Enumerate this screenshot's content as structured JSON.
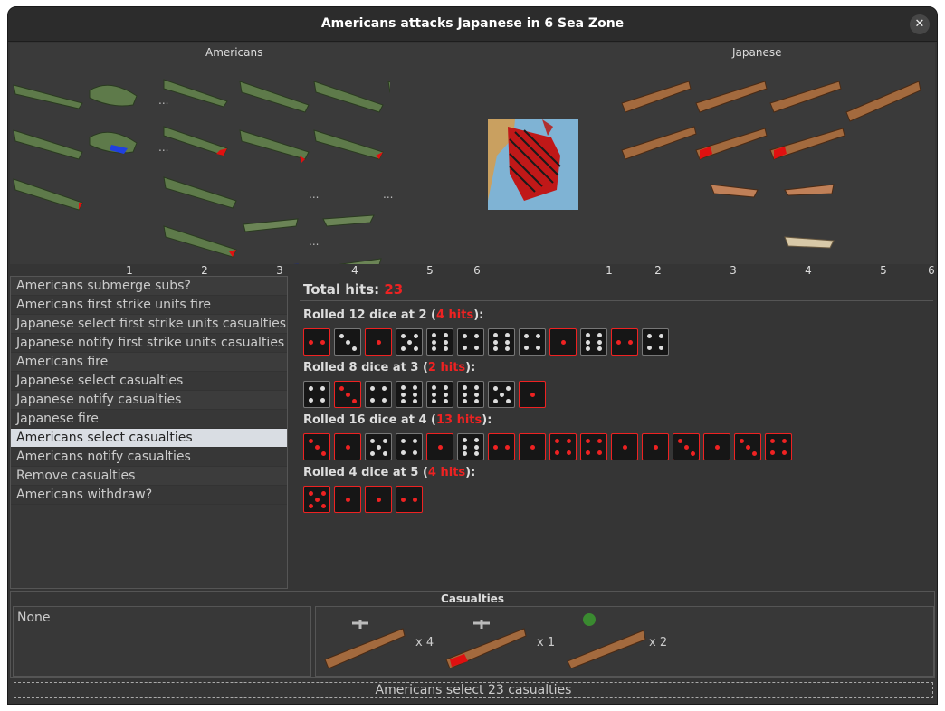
{
  "window": {
    "title": "Americans attacks Japanese in 6 Sea Zone"
  },
  "board": {
    "attacker_label": "Americans",
    "defender_label": "Japanese",
    "attacker_columns": [
      "1",
      "2",
      "3",
      "4",
      "5",
      "6"
    ],
    "defender_columns": [
      "1",
      "2",
      "3",
      "4",
      "5",
      "6"
    ],
    "colors": {
      "american_unit": "#5e7a4a",
      "japanese_unit": "#a36a3e",
      "damage": "#e01010",
      "sea": "#7fb3d4"
    }
  },
  "steps": {
    "items": [
      "Americans submerge subs?",
      "Americans first strike units fire",
      "Japanese select first strike units casualties",
      "Japanese notify first strike units casualties",
      "Americans fire",
      "Japanese select casualties",
      "Japanese notify casualties",
      "Japanese fire",
      "Americans select casualties",
      "Americans notify casualties",
      "Remove casualties",
      "Americans withdraw?"
    ],
    "selected_index": 8
  },
  "dice": {
    "total_label": "Total hits:",
    "total_hits": "23",
    "rolls": [
      {
        "prefix": "Rolled 12 dice at 2 (",
        "hits_text": "4 hits",
        "suffix": "):",
        "faces": [
          2,
          3,
          1,
          5,
          6,
          4,
          6,
          4,
          1,
          6,
          2,
          4
        ],
        "hit": [
          true,
          false,
          true,
          false,
          false,
          false,
          false,
          false,
          true,
          false,
          true,
          false
        ]
      },
      {
        "prefix": "Rolled 8 dice at 3 (",
        "hits_text": "2 hits",
        "suffix": "):",
        "faces": [
          4,
          3,
          4,
          6,
          6,
          6,
          5,
          1
        ],
        "hit": [
          false,
          true,
          false,
          false,
          false,
          false,
          false,
          true
        ]
      },
      {
        "prefix": "Rolled 16 dice at 4 (",
        "hits_text": "13 hits",
        "suffix": "):",
        "faces": [
          3,
          1,
          5,
          4,
          1,
          6,
          2,
          1,
          4,
          4,
          1,
          1,
          3,
          1,
          3,
          4
        ],
        "hit": [
          true,
          true,
          false,
          false,
          true,
          false,
          true,
          true,
          true,
          true,
          true,
          true,
          true,
          true,
          true,
          true
        ]
      },
      {
        "prefix": "Rolled 4 dice at 5 (",
        "hits_text": "4 hits",
        "suffix": "):",
        "faces": [
          5,
          1,
          1,
          2
        ],
        "hit": [
          true,
          true,
          true,
          true
        ]
      }
    ]
  },
  "casualties": {
    "title": "Casualties",
    "none_label": "None",
    "units": [
      {
        "icon": "carrier-icon",
        "count": "x 4"
      },
      {
        "icon": "damaged-carrier-icon",
        "count": "x 1"
      },
      {
        "icon": "cruiser-icon",
        "count": "x 2"
      }
    ]
  },
  "status": {
    "text": "Americans select 23 casualties"
  }
}
